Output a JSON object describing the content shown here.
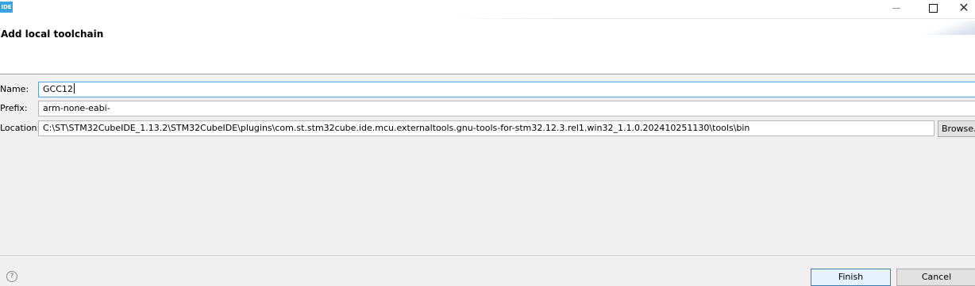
{
  "window": {
    "app_icon_text": "IDE",
    "minimize_label": "",
    "maximize_label": "",
    "close_label": "✕"
  },
  "dialog": {
    "title": "Add local toolchain"
  },
  "form": {
    "name_label": "Name:",
    "name_value": "GCC12",
    "prefix_label": "Prefix:",
    "prefix_value": "arm-none-eabi-",
    "location_label": "Location:",
    "location_value": "C:\\ST\\STM32CubeIDE_1.13.2\\STM32CubeIDE\\plugins\\com.st.stm32cube.ide.mcu.externaltools.gnu-tools-for-stm32.12.3.rel1.win32_1.1.0.202410251130\\tools\\bin",
    "browse_label": "Browse..."
  },
  "footer": {
    "help_icon": "?",
    "finish_label": "Finish",
    "cancel_label": "Cancel"
  },
  "colors": {
    "accent": "#37a3e0",
    "focus_border": "#5aa3d8"
  }
}
